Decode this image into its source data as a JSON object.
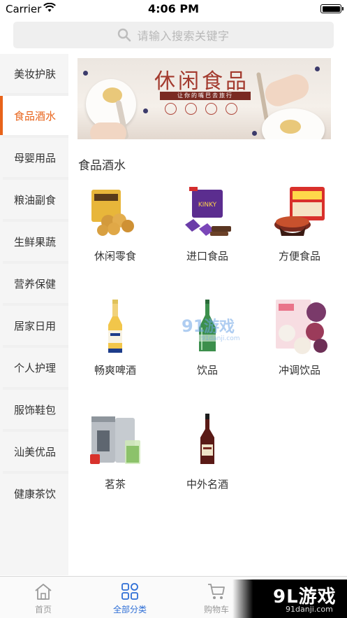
{
  "status_bar": {
    "carrier": "Carrier",
    "time": "4:06 PM"
  },
  "search": {
    "placeholder": "请输入搜索关键字"
  },
  "sidebar": {
    "items": [
      {
        "label": "美妆护肤",
        "active": false
      },
      {
        "label": "食品酒水",
        "active": true
      },
      {
        "label": "母婴用品",
        "active": false
      },
      {
        "label": "粮油副食",
        "active": false
      },
      {
        "label": "生鲜果蔬",
        "active": false
      },
      {
        "label": "营养保健",
        "active": false
      },
      {
        "label": "居家日用",
        "active": false
      },
      {
        "label": "个人护理",
        "active": false
      },
      {
        "label": "服饰鞋包",
        "active": false
      },
      {
        "label": "汕美优品",
        "active": false
      },
      {
        "label": "健康茶饮",
        "active": false
      }
    ],
    "accent_color": "#e8631a"
  },
  "banner": {
    "title": "休闲食品",
    "slogan": "让你的嘴巴去旅行"
  },
  "main": {
    "category_title": "食品酒水",
    "products": [
      {
        "label": "休闲零食",
        "icon": "snack-bag-icon"
      },
      {
        "label": "进口食品",
        "icon": "imported-chocolate-icon"
      },
      {
        "label": "方便食品",
        "icon": "instant-noodle-icon"
      },
      {
        "label": "畅爽啤酒",
        "icon": "beer-bottle-icon"
      },
      {
        "label": "饮品",
        "icon": "green-bottle-icon"
      },
      {
        "label": "冲调饮品",
        "icon": "drink-powder-box-icon"
      },
      {
        "label": "茗茶",
        "icon": "tea-tin-icon"
      },
      {
        "label": "中外名酒",
        "icon": "liquor-bottle-icon"
      }
    ]
  },
  "watermark": {
    "center_logo": "91游戏",
    "center_url": "91danji.com",
    "corner_logo": "9L游戏",
    "corner_url": "91danji.com"
  },
  "tab_bar": {
    "tabs": [
      {
        "label": "首页",
        "icon": "home-icon",
        "active": false
      },
      {
        "label": "全部分类",
        "icon": "category-grid-icon",
        "active": true
      },
      {
        "label": "购物车",
        "icon": "cart-icon",
        "active": false
      }
    ],
    "active_color": "#2f6fd6"
  }
}
